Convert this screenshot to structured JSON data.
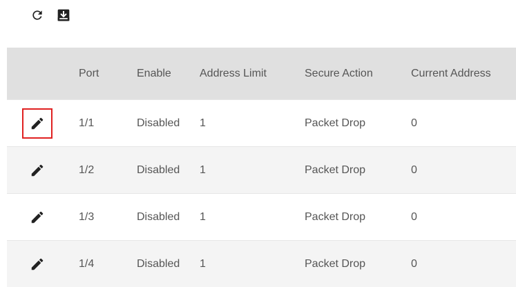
{
  "toolbar": {
    "refresh_icon": "refresh-icon",
    "export_icon": "download-icon"
  },
  "table": {
    "columns": [
      "",
      "Port",
      "Enable",
      "Address Limit",
      "Secure Action",
      "Current Address"
    ],
    "rows": [
      {
        "port": "1/1",
        "enable": "Disabled",
        "address_limit": "1",
        "secure_action": "Packet Drop",
        "current_address": "0",
        "highlighted": true
      },
      {
        "port": "1/2",
        "enable": "Disabled",
        "address_limit": "1",
        "secure_action": "Packet Drop",
        "current_address": "0",
        "highlighted": false
      },
      {
        "port": "1/3",
        "enable": "Disabled",
        "address_limit": "1",
        "secure_action": "Packet Drop",
        "current_address": "0",
        "highlighted": false
      },
      {
        "port": "1/4",
        "enable": "Disabled",
        "address_limit": "1",
        "secure_action": "Packet Drop",
        "current_address": "0",
        "highlighted": false
      }
    ]
  },
  "colors": {
    "header_bg": "#e0e0e0",
    "alt_row_bg": "#f4f4f4",
    "highlight_border": "#e02020",
    "icon": "#222222"
  }
}
